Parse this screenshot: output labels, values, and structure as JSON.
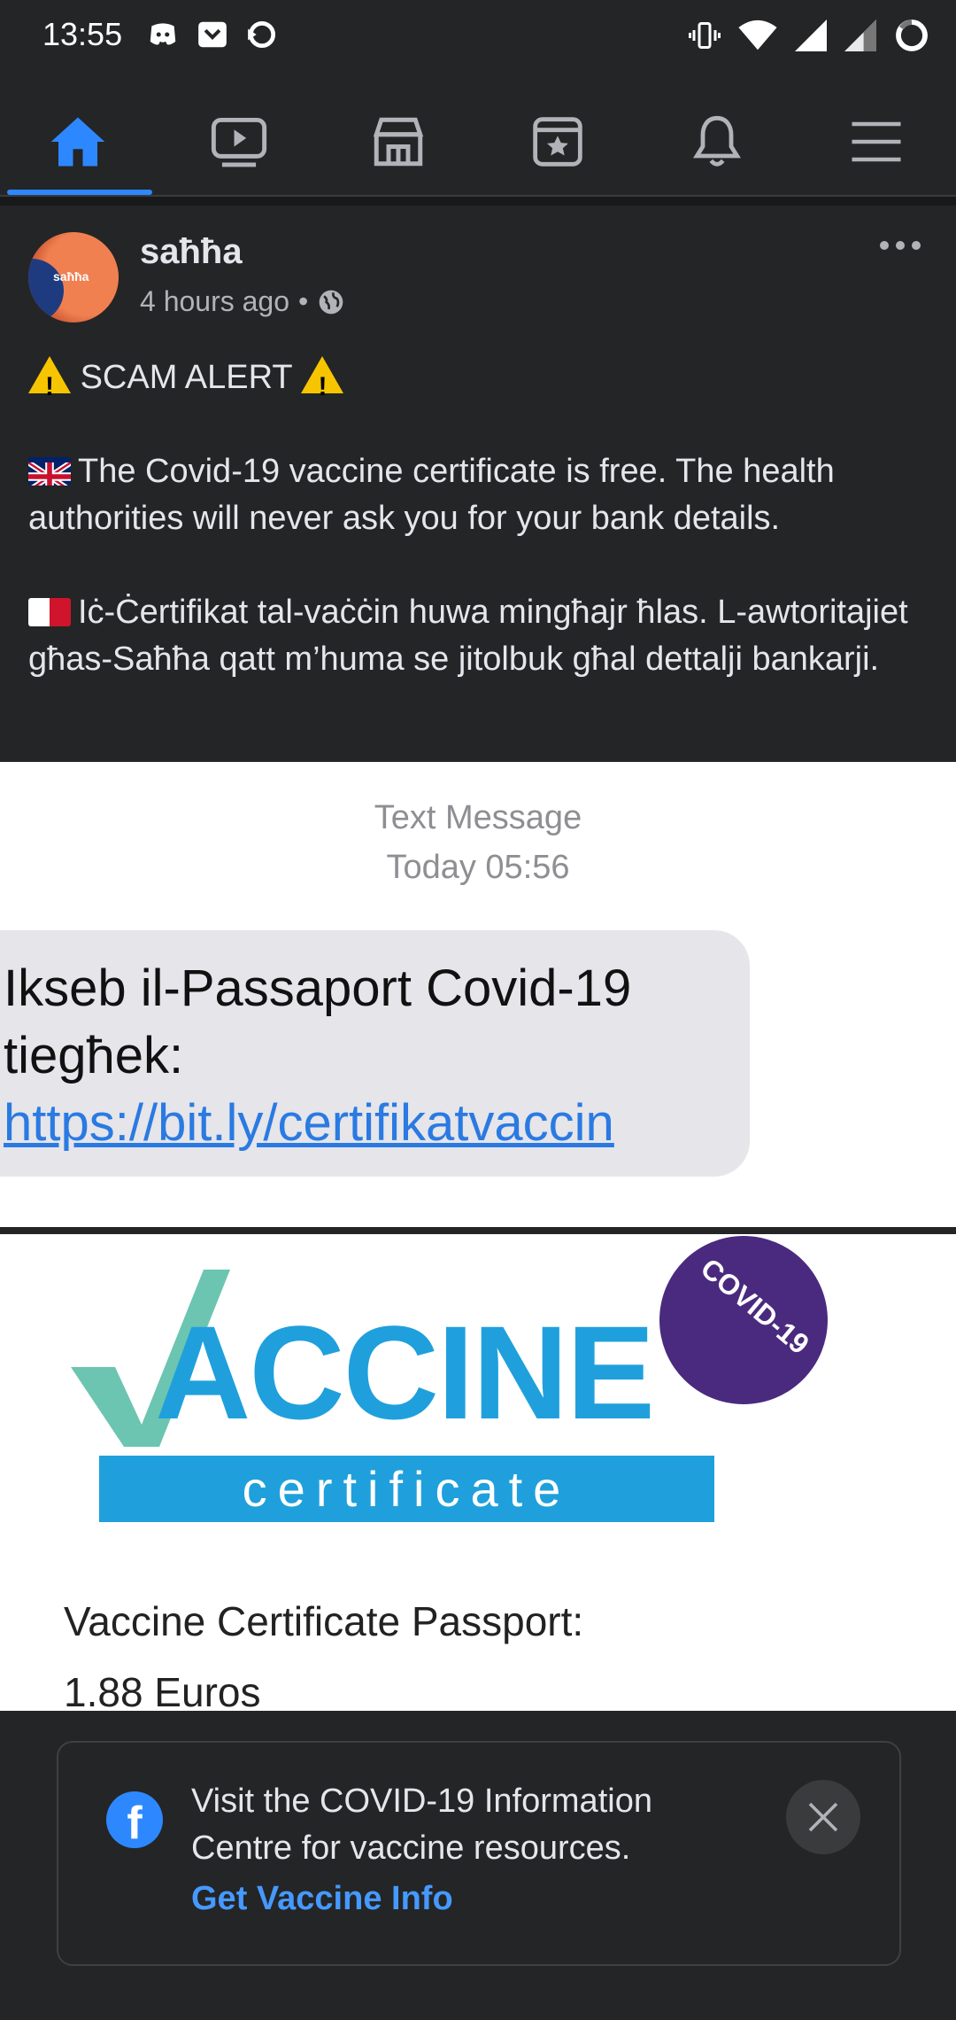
{
  "status_bar": {
    "time": "13:55"
  },
  "nav": {
    "items": [
      "home",
      "watch",
      "marketplace",
      "favorites",
      "notifications",
      "menu"
    ],
    "active": "home",
    "accent": "#2d88ff"
  },
  "post": {
    "author": "saħħa",
    "avatar_text": "saħħa",
    "time": "4 hours ago",
    "visibility_separator": "•",
    "lines": {
      "alert": "SCAM ALERT",
      "english": "The Covid-19 vaccine certificate is free. The health authorities will never ask you for your bank details.",
      "maltese": "Iċ-Ċertifikat tal-vaċċin huwa mingħajr ħlas. L-awtoritajiet għas-Saħħa qatt m’huma se jitolbuk għal dettalji bankarji."
    }
  },
  "sms_image": {
    "header_line1": "Text Message",
    "header_line2": "Today 05:56",
    "message_prefix": "Ikseb il-Passaport Covid-19 tiegħek: ",
    "link": "https://bit.ly/certifikatvaccin"
  },
  "certificate_image": {
    "badge": "COVID-19",
    "word": "ACCINE",
    "subtitle": "certificate",
    "label": "Vaccine Certificate Passport:",
    "price": "1.88 Euros"
  },
  "info_card": {
    "text": "Visit the COVID-19 Information Centre for vaccine resources.",
    "link": "Get Vaccine Info",
    "fb_letter": "f"
  }
}
